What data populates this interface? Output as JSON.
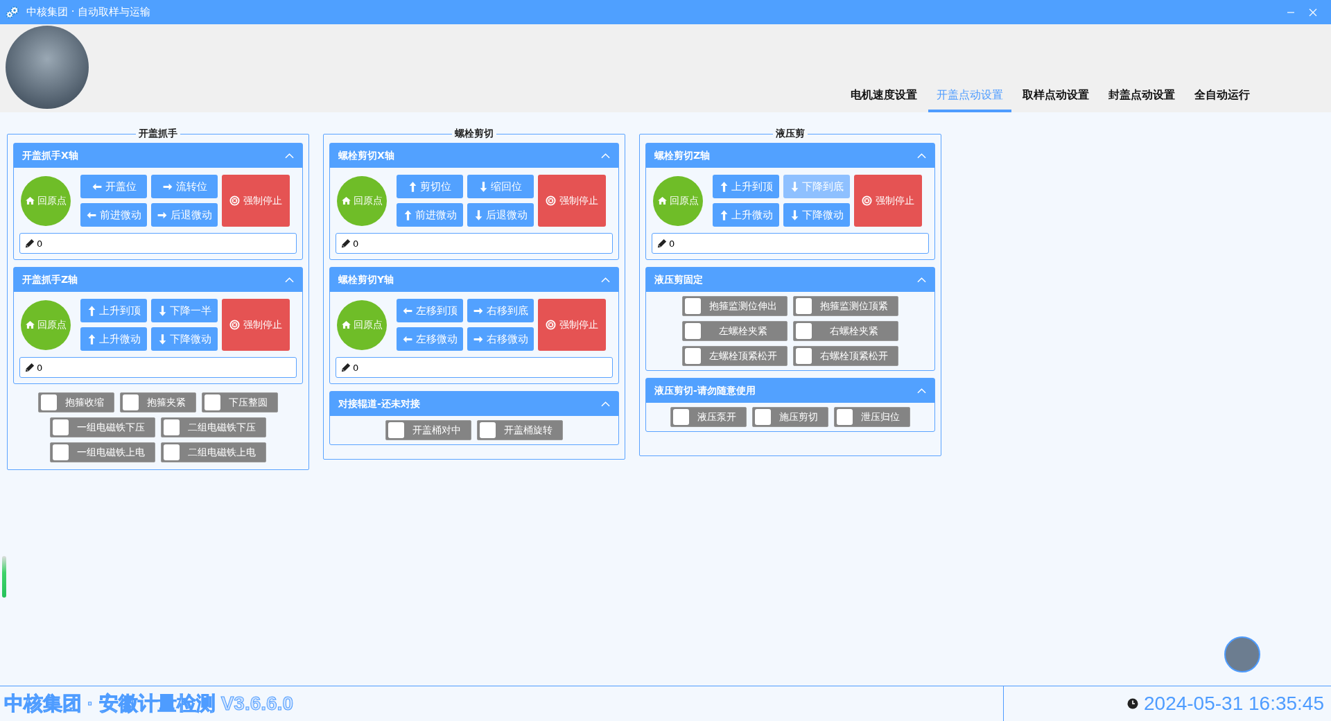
{
  "window": {
    "title": "中核集团 ·  自动取样与运输"
  },
  "tabs": [
    {
      "label": "电机速度设置",
      "selected": false
    },
    {
      "label": "开盖点动设置",
      "selected": true
    },
    {
      "label": "取样点动设置",
      "selected": false
    },
    {
      "label": "封盖点动设置",
      "selected": false
    },
    {
      "label": "全自动运行",
      "selected": false
    }
  ],
  "groups": [
    {
      "title": "开盖抓手",
      "sections": [
        {
          "kind": "axis",
          "title": "开盖抓手X轴",
          "expanded": true,
          "home": "回原点",
          "moves": [
            {
              "label": "开盖位",
              "kind": "left",
              "disabled": false
            },
            {
              "label": "流转位",
              "kind": "right",
              "disabled": false
            },
            {
              "label": "前进微动",
              "kind": "left",
              "disabled": false
            },
            {
              "label": "后退微动",
              "kind": "right",
              "disabled": false
            }
          ],
          "stop": "强制停止",
          "value": "0"
        },
        {
          "kind": "axis",
          "title": "开盖抓手Z轴",
          "expanded": true,
          "home": "回原点",
          "moves": [
            {
              "label": "上升到顶",
              "kind": "up",
              "disabled": false
            },
            {
              "label": "下降一半",
              "kind": "down",
              "disabled": false
            },
            {
              "label": "上升微动",
              "kind": "up",
              "disabled": false
            },
            {
              "label": "下降微动",
              "kind": "down",
              "disabled": false
            }
          ],
          "stop": "强制停止",
          "value": "0"
        },
        {
          "kind": "loose-toggles",
          "rows": [
            [
              {
                "label": "抱箍收缩",
                "checked": false
              },
              {
                "label": "抱箍夹紧",
                "checked": false
              },
              {
                "label": "下压整圆",
                "checked": false
              }
            ],
            [
              {
                "label": "一组电磁铁下压",
                "checked": false
              },
              {
                "label": "二组电磁铁下压",
                "checked": false
              }
            ],
            [
              {
                "label": "一组电磁铁上电",
                "checked": false
              },
              {
                "label": "二组电磁铁上电",
                "checked": false
              }
            ]
          ]
        }
      ]
    },
    {
      "title": "螺栓剪切",
      "sections": [
        {
          "kind": "axis",
          "title": "螺栓剪切X轴",
          "expanded": true,
          "home": "回原点",
          "moves": [
            {
              "label": "剪切位",
              "kind": "up",
              "disabled": false
            },
            {
              "label": "缩回位",
              "kind": "down",
              "disabled": false
            },
            {
              "label": "前进微动",
              "kind": "up",
              "disabled": false
            },
            {
              "label": "后退微动",
              "kind": "down",
              "disabled": false
            }
          ],
          "stop": "强制停止",
          "value": "0"
        },
        {
          "kind": "axis",
          "title": "螺栓剪切Y轴",
          "expanded": true,
          "home": "回原点",
          "moves": [
            {
              "label": "左移到顶",
              "kind": "left",
              "disabled": false
            },
            {
              "label": "右移到底",
              "kind": "right",
              "disabled": false
            },
            {
              "label": "左移微动",
              "kind": "left",
              "disabled": false
            },
            {
              "label": "右移微动",
              "kind": "right",
              "disabled": false
            }
          ],
          "stop": "强制停止",
          "value": "0"
        },
        {
          "kind": "toggles",
          "title": "对接辊道-还未对接",
          "expanded": true,
          "rows": [
            [
              {
                "label": "开盖桶对中",
                "checked": false
              },
              {
                "label": "开盖桶旋转",
                "checked": false
              }
            ]
          ]
        }
      ]
    },
    {
      "title": "液压剪",
      "sections": [
        {
          "kind": "axis",
          "title": "螺栓剪切Z轴",
          "expanded": true,
          "home": "回原点",
          "moves": [
            {
              "label": "上升到顶",
              "kind": "up",
              "disabled": false
            },
            {
              "label": "下降到底",
              "kind": "down",
              "disabled": true
            },
            {
              "label": "上升微动",
              "kind": "up",
              "disabled": false
            },
            {
              "label": "下降微动",
              "kind": "down",
              "disabled": false
            }
          ],
          "stop": "强制停止",
          "value": "0"
        },
        {
          "kind": "toggles",
          "title": "液压剪固定",
          "expanded": true,
          "rows": [
            [
              {
                "label": "抱箍监测位伸出",
                "checked": false
              },
              {
                "label": "抱箍监测位顶紧",
                "checked": false
              }
            ],
            [
              {
                "label": "左螺栓夹紧",
                "checked": false
              },
              {
                "label": "右螺栓夹紧",
                "checked": false
              }
            ],
            [
              {
                "label": "左螺栓顶紧松开",
                "checked": false
              },
              {
                "label": "右螺栓顶紧松开",
                "checked": false
              }
            ]
          ]
        },
        {
          "kind": "toggles",
          "title": "液压剪切-请勿随意使用",
          "expanded": true,
          "rows": [
            [
              {
                "label": "液压泵开",
                "checked": false
              },
              {
                "label": "施压剪切",
                "checked": false
              },
              {
                "label": "泄压归位",
                "checked": false
              }
            ]
          ]
        }
      ]
    }
  ],
  "footer": {
    "title": "中核集团 · 安徽计量检测 V3.6.6.0",
    "datetime": "2024-05-31 16:35:45"
  }
}
